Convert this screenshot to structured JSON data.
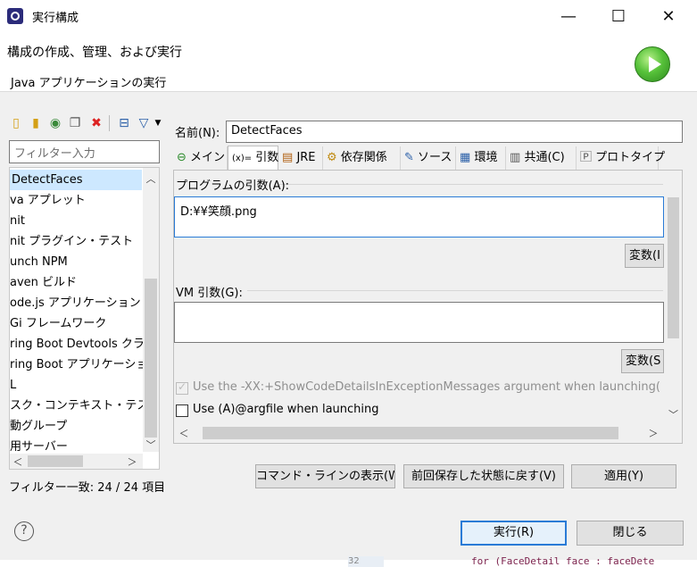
{
  "window": {
    "title": "実行構成",
    "minimize": "—",
    "maximize": "☐",
    "close": "✕"
  },
  "header": {
    "title": "構成の作成、管理、および実行",
    "subtitle": "Java アプリケーションの実行"
  },
  "toolbar": {
    "icons": [
      "new-config-icon",
      "new-prototype-icon",
      "export-icon",
      "duplicate-icon",
      "delete-icon",
      "collapse-all-icon",
      "filter-icon",
      "chevron-down-icon"
    ]
  },
  "filter": {
    "placeholder": "フィルター入力",
    "status": "フィルター一致: 24 / 24 項目"
  },
  "tree": {
    "items": [
      "DetectFaces",
      "va アプレット",
      "nit",
      "nit プラグイン・テスト",
      "unch NPM",
      "aven ビルド",
      "ode.js アプリケーション",
      "Gi フレームワーク",
      "ring Boot Devtools クラ",
      "ring Boot アプリケーション",
      "L",
      "スク・コンテキスト・テスト",
      "動グループ",
      "用サーバー"
    ],
    "selected": 0
  },
  "name": {
    "label": "名前(N):",
    "value": "DetectFaces"
  },
  "tabs": [
    {
      "label": "メイン",
      "icon": "main-tab-icon"
    },
    {
      "label": "引数",
      "icon": "args-tab-icon",
      "prefix": "(x)="
    },
    {
      "label": "JRE",
      "icon": "jre-tab-icon"
    },
    {
      "label": "依存関係",
      "icon": "dependency-tab-icon"
    },
    {
      "label": "ソース",
      "icon": "source-tab-icon"
    },
    {
      "label": "環境",
      "icon": "environment-tab-icon"
    },
    {
      "label": "共通(C)",
      "icon": "common-tab-icon"
    },
    {
      "label": "プロトタイプ",
      "icon": "prototype-tab-icon"
    }
  ],
  "args": {
    "program_label": "プログラムの引数(A):",
    "program_value": "D:¥¥笑顔.png",
    "variables1": "変数(I",
    "vm_label": "VM 引数(G):",
    "vm_value": "",
    "variables2": "変数(S",
    "show_details": "Use the -XX:+ShowCodeDetailsInExceptionMessages argument when launching(",
    "argfile": "Use (A)@argfile when launching"
  },
  "buttons": {
    "cmdline": "コマンド・ラインの表示(W)",
    "revert": "前回保存した状態に戻す(V)",
    "apply": "適用(Y)",
    "run": "実行(R)",
    "close": "閉じる",
    "help": "?"
  },
  "background_text": {
    "line": "32",
    "code": "for (FaceDetail face : faceDete"
  }
}
